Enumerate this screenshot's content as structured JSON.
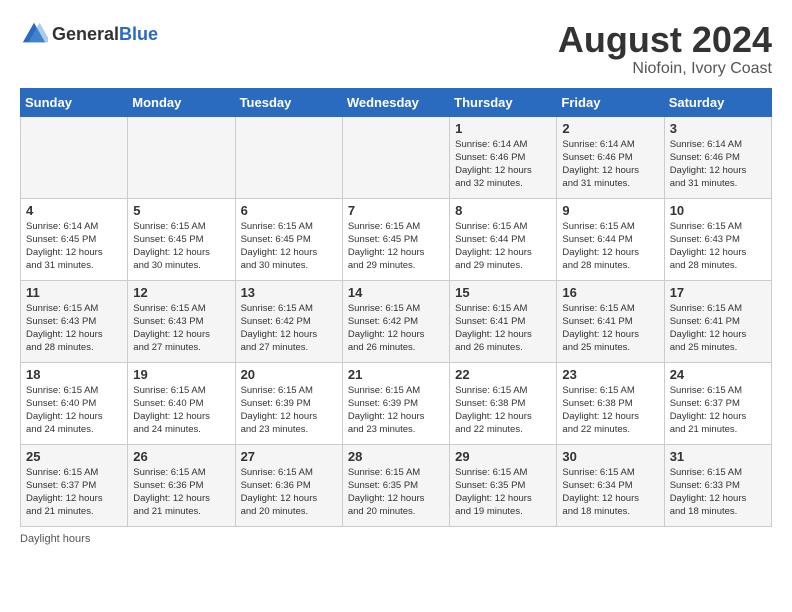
{
  "header": {
    "logo_general": "General",
    "logo_blue": "Blue",
    "month_year": "August 2024",
    "location": "Niofoin, Ivory Coast"
  },
  "footer": {
    "note": "Daylight hours"
  },
  "days_of_week": [
    "Sunday",
    "Monday",
    "Tuesday",
    "Wednesday",
    "Thursday",
    "Friday",
    "Saturday"
  ],
  "weeks": [
    [
      {
        "num": "",
        "info": ""
      },
      {
        "num": "",
        "info": ""
      },
      {
        "num": "",
        "info": ""
      },
      {
        "num": "",
        "info": ""
      },
      {
        "num": "1",
        "info": "Sunrise: 6:14 AM\nSunset: 6:46 PM\nDaylight: 12 hours\nand 32 minutes."
      },
      {
        "num": "2",
        "info": "Sunrise: 6:14 AM\nSunset: 6:46 PM\nDaylight: 12 hours\nand 31 minutes."
      },
      {
        "num": "3",
        "info": "Sunrise: 6:14 AM\nSunset: 6:46 PM\nDaylight: 12 hours\nand 31 minutes."
      }
    ],
    [
      {
        "num": "4",
        "info": "Sunrise: 6:14 AM\nSunset: 6:45 PM\nDaylight: 12 hours\nand 31 minutes."
      },
      {
        "num": "5",
        "info": "Sunrise: 6:15 AM\nSunset: 6:45 PM\nDaylight: 12 hours\nand 30 minutes."
      },
      {
        "num": "6",
        "info": "Sunrise: 6:15 AM\nSunset: 6:45 PM\nDaylight: 12 hours\nand 30 minutes."
      },
      {
        "num": "7",
        "info": "Sunrise: 6:15 AM\nSunset: 6:45 PM\nDaylight: 12 hours\nand 29 minutes."
      },
      {
        "num": "8",
        "info": "Sunrise: 6:15 AM\nSunset: 6:44 PM\nDaylight: 12 hours\nand 29 minutes."
      },
      {
        "num": "9",
        "info": "Sunrise: 6:15 AM\nSunset: 6:44 PM\nDaylight: 12 hours\nand 28 minutes."
      },
      {
        "num": "10",
        "info": "Sunrise: 6:15 AM\nSunset: 6:43 PM\nDaylight: 12 hours\nand 28 minutes."
      }
    ],
    [
      {
        "num": "11",
        "info": "Sunrise: 6:15 AM\nSunset: 6:43 PM\nDaylight: 12 hours\nand 28 minutes."
      },
      {
        "num": "12",
        "info": "Sunrise: 6:15 AM\nSunset: 6:43 PM\nDaylight: 12 hours\nand 27 minutes."
      },
      {
        "num": "13",
        "info": "Sunrise: 6:15 AM\nSunset: 6:42 PM\nDaylight: 12 hours\nand 27 minutes."
      },
      {
        "num": "14",
        "info": "Sunrise: 6:15 AM\nSunset: 6:42 PM\nDaylight: 12 hours\nand 26 minutes."
      },
      {
        "num": "15",
        "info": "Sunrise: 6:15 AM\nSunset: 6:41 PM\nDaylight: 12 hours\nand 26 minutes."
      },
      {
        "num": "16",
        "info": "Sunrise: 6:15 AM\nSunset: 6:41 PM\nDaylight: 12 hours\nand 25 minutes."
      },
      {
        "num": "17",
        "info": "Sunrise: 6:15 AM\nSunset: 6:41 PM\nDaylight: 12 hours\nand 25 minutes."
      }
    ],
    [
      {
        "num": "18",
        "info": "Sunrise: 6:15 AM\nSunset: 6:40 PM\nDaylight: 12 hours\nand 24 minutes."
      },
      {
        "num": "19",
        "info": "Sunrise: 6:15 AM\nSunset: 6:40 PM\nDaylight: 12 hours\nand 24 minutes."
      },
      {
        "num": "20",
        "info": "Sunrise: 6:15 AM\nSunset: 6:39 PM\nDaylight: 12 hours\nand 23 minutes."
      },
      {
        "num": "21",
        "info": "Sunrise: 6:15 AM\nSunset: 6:39 PM\nDaylight: 12 hours\nand 23 minutes."
      },
      {
        "num": "22",
        "info": "Sunrise: 6:15 AM\nSunset: 6:38 PM\nDaylight: 12 hours\nand 22 minutes."
      },
      {
        "num": "23",
        "info": "Sunrise: 6:15 AM\nSunset: 6:38 PM\nDaylight: 12 hours\nand 22 minutes."
      },
      {
        "num": "24",
        "info": "Sunrise: 6:15 AM\nSunset: 6:37 PM\nDaylight: 12 hours\nand 21 minutes."
      }
    ],
    [
      {
        "num": "25",
        "info": "Sunrise: 6:15 AM\nSunset: 6:37 PM\nDaylight: 12 hours\nand 21 minutes."
      },
      {
        "num": "26",
        "info": "Sunrise: 6:15 AM\nSunset: 6:36 PM\nDaylight: 12 hours\nand 21 minutes."
      },
      {
        "num": "27",
        "info": "Sunrise: 6:15 AM\nSunset: 6:36 PM\nDaylight: 12 hours\nand 20 minutes."
      },
      {
        "num": "28",
        "info": "Sunrise: 6:15 AM\nSunset: 6:35 PM\nDaylight: 12 hours\nand 20 minutes."
      },
      {
        "num": "29",
        "info": "Sunrise: 6:15 AM\nSunset: 6:35 PM\nDaylight: 12 hours\nand 19 minutes."
      },
      {
        "num": "30",
        "info": "Sunrise: 6:15 AM\nSunset: 6:34 PM\nDaylight: 12 hours\nand 18 minutes."
      },
      {
        "num": "31",
        "info": "Sunrise: 6:15 AM\nSunset: 6:33 PM\nDaylight: 12 hours\nand 18 minutes."
      }
    ]
  ]
}
